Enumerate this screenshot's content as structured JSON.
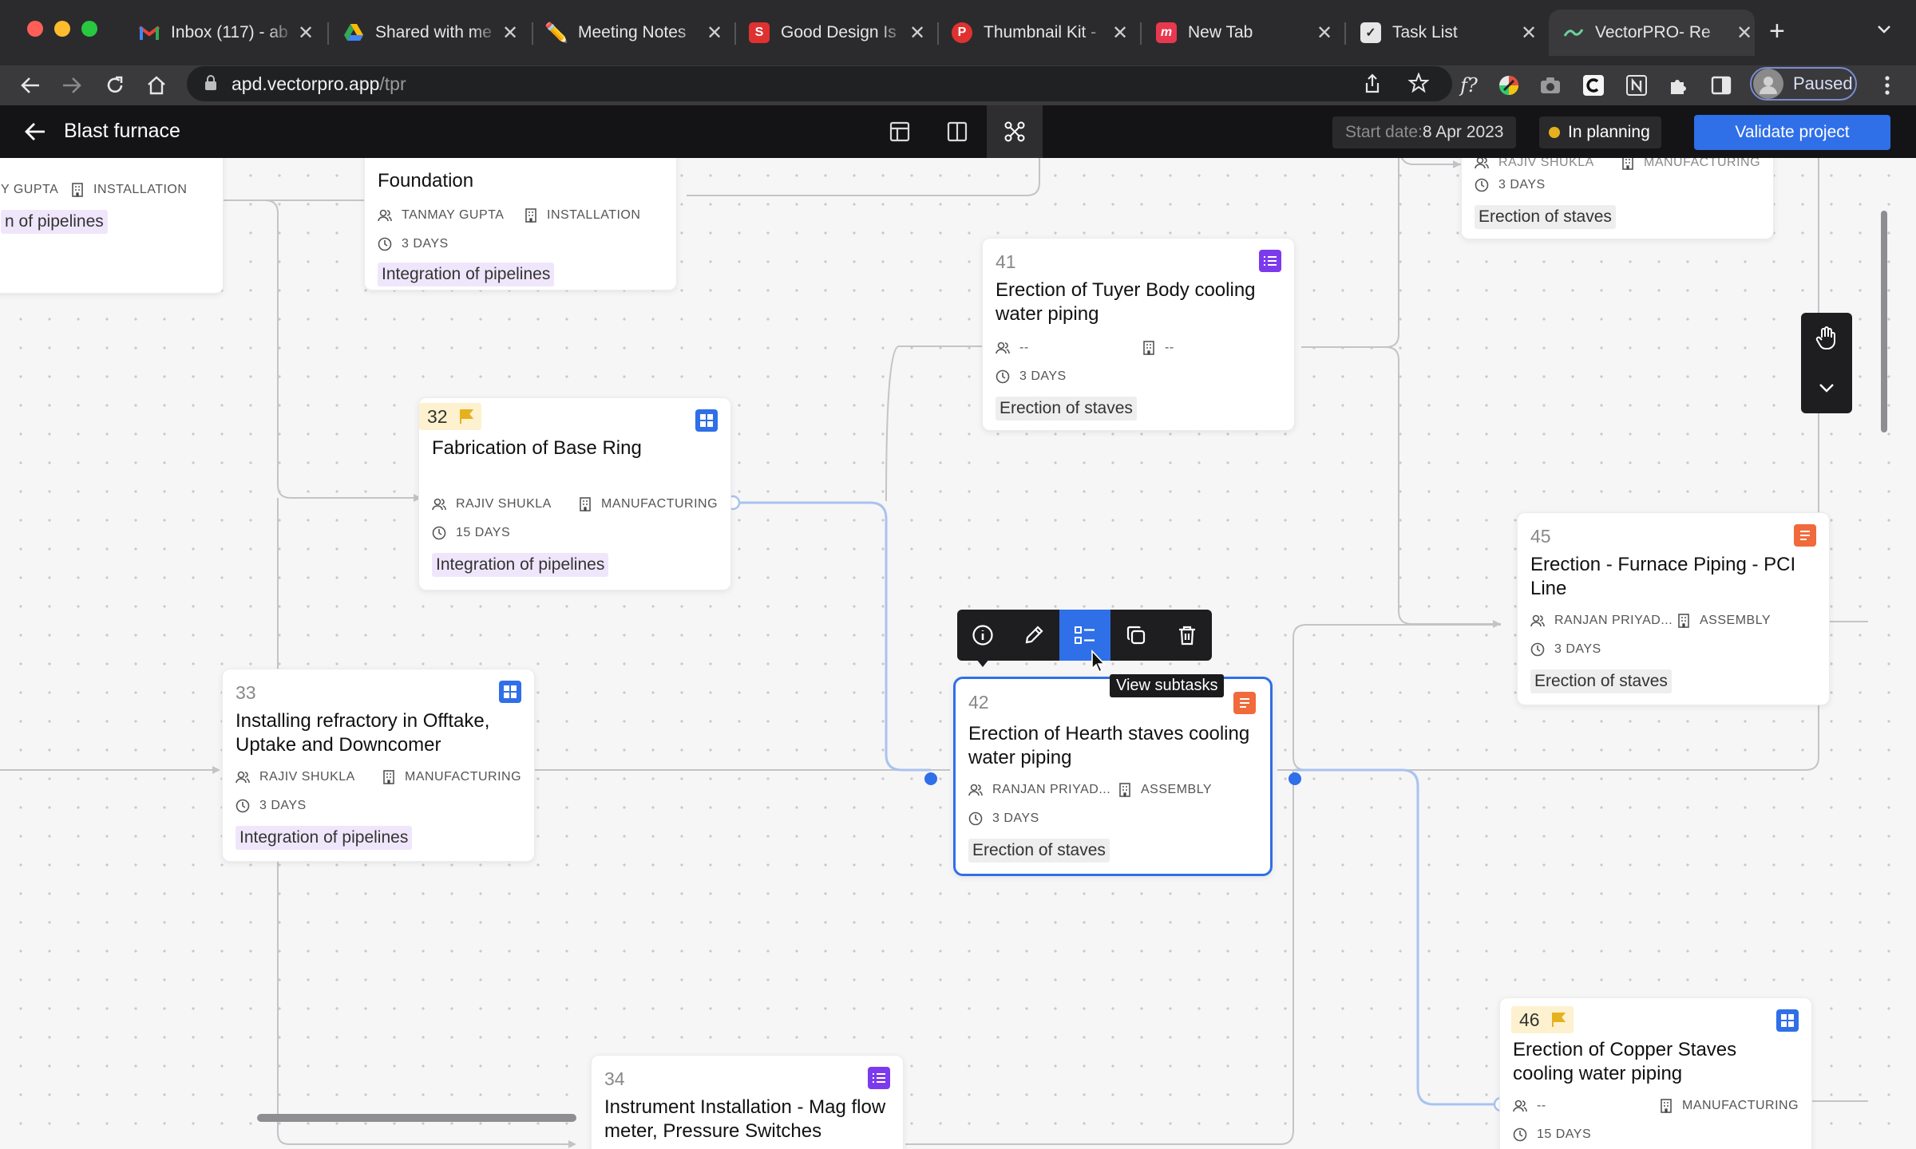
{
  "browser": {
    "tabs": [
      {
        "title": "Inbox (117) - ab",
        "favicon": "gmail-icon",
        "color": "#ea4335"
      },
      {
        "title": "Shared with me",
        "favicon": "drive-icon",
        "color": "#34a853"
      },
      {
        "title": "Meeting Notes",
        "favicon": "pencil-icon",
        "color": "#f4b400"
      },
      {
        "title": "Good Design Is",
        "favicon": "s-icon",
        "color": "#e03131"
      },
      {
        "title": "Thumbnail Kit -",
        "favicon": "p-icon",
        "color": "#e03131"
      },
      {
        "title": "New Tab",
        "favicon": "m-icon",
        "color": "#e8384f"
      },
      {
        "title": "Task List",
        "favicon": "check-icon",
        "color": "#dddddd"
      },
      {
        "title": "VectorPRO- Re",
        "favicon": "vector-icon",
        "color": "#6dd19b"
      }
    ],
    "url_host": "apd.vectorpro.app",
    "url_path": "/tpr",
    "profile_label": "Paused"
  },
  "header": {
    "title": "Blast furnace",
    "start_label": "Start date:",
    "start_value": "8 Apr 2023",
    "status": "In planning",
    "validate_label": "Validate project"
  },
  "cards": {
    "c_left": {
      "assignee": "Y GUPTA",
      "dept": "INSTALLATION",
      "tag": "n of pipelines"
    },
    "c_found": {
      "title": "Foundation",
      "assignee": "TANMAY GUPTA",
      "dept": "INSTALLATION",
      "duration": "3 DAYS",
      "tag": "Integration of pipelines"
    },
    "c41": {
      "num": "41",
      "title": "Erection of Tuyer Body cooling water piping",
      "assignee": "--",
      "dept": "--",
      "duration": "3 DAYS",
      "tag": "Erection of staves"
    },
    "c_topright": {
      "assignee": "RAJIV SHUKLA",
      "dept": "MANUFACTURING",
      "duration": "3 DAYS",
      "tag": "Erection of staves"
    },
    "c32": {
      "num": "32",
      "title": "Fabrication of Base Ring",
      "assignee": "RAJIV SHUKLA",
      "dept": "MANUFACTURING",
      "duration": "15 DAYS",
      "tag": "Integration of pipelines"
    },
    "c45": {
      "num": "45",
      "title": "Erection - Furnace Piping - PCI Line",
      "assignee": "RANJAN PRIYAD...",
      "dept": "ASSEMBLY",
      "duration": "3 DAYS",
      "tag": "Erection of staves"
    },
    "c33": {
      "num": "33",
      "title": "Installing refractory in Offtake, Uptake and Downcomer",
      "assignee": "RAJIV SHUKLA",
      "dept": "MANUFACTURING",
      "duration": "3 DAYS",
      "tag": "Integration of pipelines"
    },
    "c42": {
      "num": "42",
      "title": "Erection of Hearth staves cooling water piping",
      "assignee": "RANJAN PRIYAD...",
      "dept": "ASSEMBLY",
      "duration": "3 DAYS",
      "tag": "Erection of staves"
    },
    "c46": {
      "num": "46",
      "title": "Erection of Copper Staves cooling water piping",
      "assignee": "--",
      "dept": "MANUFACTURING",
      "duration": "15 DAYS"
    },
    "c34": {
      "num": "34",
      "title": "Instrument Installation - Mag flow meter, Pressure Switches"
    }
  },
  "node_toolbar": {
    "tooltip": "View subtasks",
    "actions": [
      "info-icon",
      "edit-icon",
      "subtasks-icon",
      "duplicate-icon",
      "delete-icon"
    ]
  },
  "colors": {
    "accent": "#2f6fe8",
    "edge": "#a9c3ef",
    "status_dot": "#e6b11e",
    "task_icon_grid": "#2f6fe8",
    "task_icon_list": "#7c3aed",
    "task_icon_doc": "#f06a3b"
  }
}
